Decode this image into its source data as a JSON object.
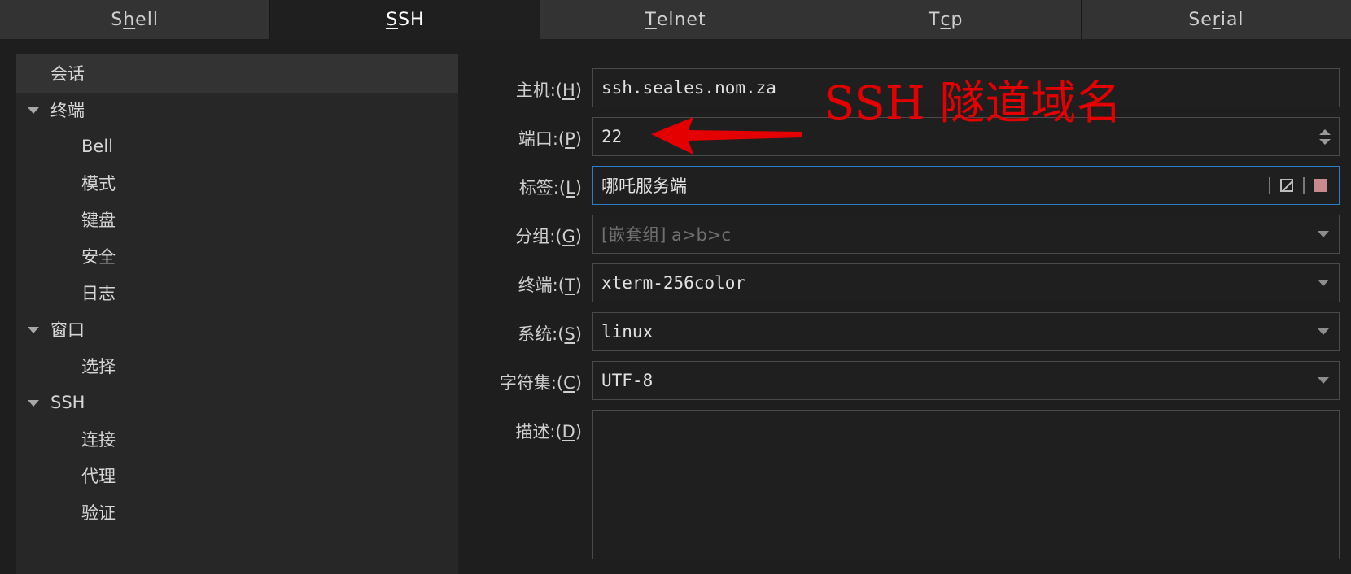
{
  "tabs": [
    {
      "pre": "S",
      "u": "h",
      "post": "ell"
    },
    {
      "pre": "",
      "u": "S",
      "post": "SH"
    },
    {
      "pre": "",
      "u": "T",
      "post": "elnet"
    },
    {
      "pre": "T",
      "u": "c",
      "post": "p"
    },
    {
      "pre": "Se",
      "u": "r",
      "post": "ial"
    }
  ],
  "active_tab": "SSH",
  "tree": [
    {
      "label": "会话",
      "level": 0,
      "expandable": false,
      "selected": true
    },
    {
      "label": "终端",
      "level": 0,
      "expandable": true
    },
    {
      "label": "Bell",
      "level": 1
    },
    {
      "label": "模式",
      "level": 1
    },
    {
      "label": "键盘",
      "level": 1
    },
    {
      "label": "安全",
      "level": 1
    },
    {
      "label": "日志",
      "level": 1
    },
    {
      "label": "窗口",
      "level": 0,
      "expandable": true
    },
    {
      "label": "选择",
      "level": 1
    },
    {
      "label": "SSH",
      "level": 0,
      "expandable": true
    },
    {
      "label": "连接",
      "level": 1
    },
    {
      "label": "代理",
      "level": 1
    },
    {
      "label": "验证",
      "level": 1
    }
  ],
  "form": {
    "host": {
      "label": "主机:(",
      "key": "H",
      "value": "ssh.seales.nom.za"
    },
    "port": {
      "label": "端口:(",
      "key": "P",
      "value": "22"
    },
    "tag": {
      "label": "标签:(",
      "key": "L",
      "value": "哪吒服务端"
    },
    "group": {
      "label": "分组:(",
      "key": "G",
      "placeholder": "[嵌套组] a>b>c"
    },
    "terminal": {
      "label": "终端:(",
      "key": "T",
      "value": "xterm-256color"
    },
    "system": {
      "label": "系统:(",
      "key": "S",
      "value": "linux"
    },
    "charset": {
      "label": "字符集:(",
      "key": "C",
      "value": "UTF-8"
    },
    "description": {
      "label": "描述:(",
      "key": "D",
      "value": ""
    }
  },
  "close_paren": ")",
  "annotation": {
    "text": "SSH 隧道域名",
    "color": "#e40000"
  },
  "colors": {
    "accent_focus": "#2d7ec9",
    "tag_color_swatch": "#c88a8c"
  }
}
